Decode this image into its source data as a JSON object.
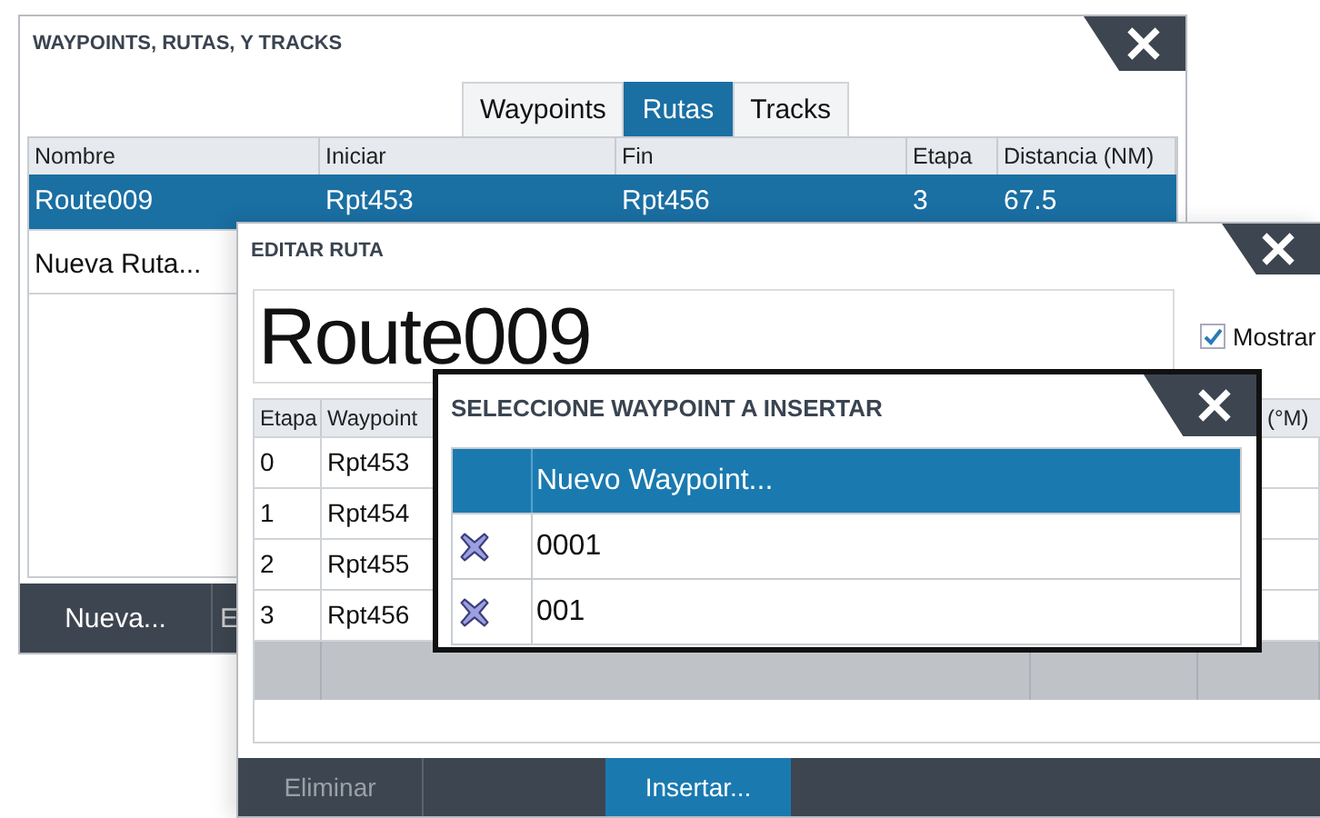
{
  "main_window": {
    "title": "WAYPOINTS, RUTAS, Y TRACKS",
    "tabs": [
      {
        "label": "Waypoints",
        "selected": false
      },
      {
        "label": "Rutas",
        "selected": true
      },
      {
        "label": "Tracks",
        "selected": false
      }
    ],
    "table": {
      "columns": [
        "Nombre",
        "Iniciar",
        "Fin",
        "Etapa",
        "Distancia (NM)"
      ],
      "rows": [
        {
          "cells": [
            "Route009",
            "Rpt453",
            "Rpt456",
            "3",
            "67.5"
          ],
          "selected": true
        },
        {
          "cells": [
            "Nueva Ruta..."
          ],
          "selected": false
        }
      ]
    },
    "buttons": [
      {
        "label": "Nueva..."
      },
      {
        "label": "E"
      }
    ]
  },
  "edit_window": {
    "title": "EDITAR RUTA",
    "route_name": "Route009",
    "show_checkbox": {
      "label": "Mostrar",
      "checked": true
    },
    "table": {
      "columns": [
        "Etapa",
        "Waypoint",
        "",
        "(°M)"
      ],
      "rows": [
        {
          "cells": [
            "0",
            "Rpt453"
          ]
        },
        {
          "cells": [
            "1",
            "Rpt454"
          ]
        },
        {
          "cells": [
            "2",
            "Rpt455"
          ]
        },
        {
          "cells": [
            "3",
            "Rpt456"
          ]
        }
      ]
    },
    "buttons": [
      {
        "label": "Eliminar",
        "disabled": true,
        "highlighted": false
      },
      {
        "label": "Insertar...",
        "disabled": false,
        "highlighted": true
      }
    ]
  },
  "select_dialog": {
    "title": "SELECCIONE WAYPOINT A INSERTAR",
    "items": [
      {
        "kind": "new",
        "label": "Nuevo Waypoint...",
        "selected": true
      },
      {
        "kind": "waypoint",
        "label": "0001",
        "selected": false
      },
      {
        "kind": "waypoint",
        "label": "001",
        "selected": false
      }
    ]
  }
}
